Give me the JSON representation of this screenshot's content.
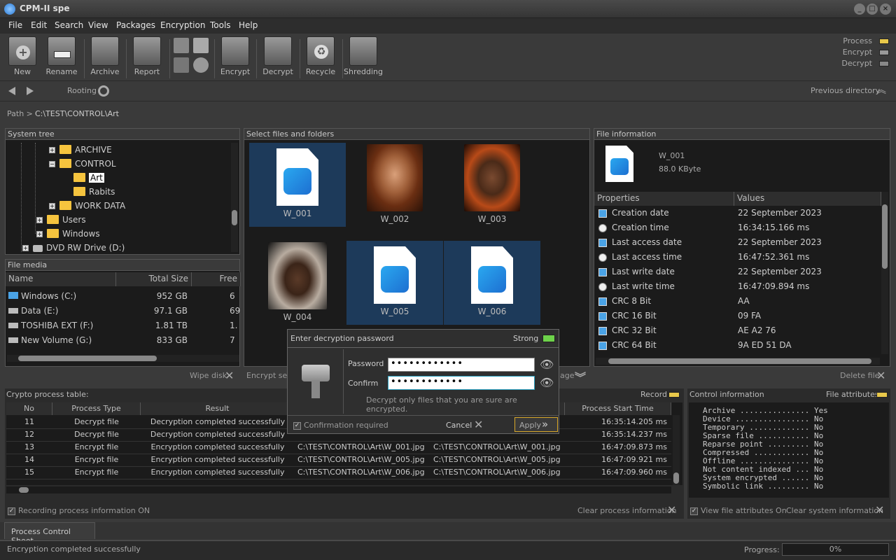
{
  "app": {
    "title": "CPM-II spe"
  },
  "menu": [
    "File",
    "Edit",
    "Search",
    "View",
    "Packages",
    "Encryption",
    "Tools",
    "Help"
  ],
  "toolbar": {
    "buttons": [
      "New",
      "Rename",
      "Archive",
      "Report",
      "Encrypt",
      "Decrypt",
      "Recycle",
      "Shredding"
    ]
  },
  "status_indicators": {
    "process": "Process",
    "encrypt": "Encrypt",
    "decrypt": "Decrypt",
    "colors": {
      "process": "#e8c84a",
      "encrypt": "#999999",
      "decrypt": "#888888"
    }
  },
  "nav": {
    "rooting": "Rooting",
    "previous_directory": "Previous directory"
  },
  "path": {
    "label": "Path >",
    "value": "C:\\TEST\\CONTROL\\Art"
  },
  "system_tree": {
    "title": "System tree",
    "items": [
      {
        "label": "ARCHIVE",
        "sign": "+"
      },
      {
        "label": "CONTROL",
        "sign": "−"
      },
      {
        "label": "Art",
        "sign": ""
      },
      {
        "label": "Rabits",
        "sign": ""
      },
      {
        "label": "WORK DATA",
        "sign": "+"
      },
      {
        "label": "Users",
        "sign": "+"
      },
      {
        "label": "Windows",
        "sign": "+"
      },
      {
        "label": "DVD RW Drive (D:)",
        "sign": "+"
      }
    ]
  },
  "file_media": {
    "title": "File media",
    "headers": [
      "Name",
      "Total Size",
      "Free"
    ],
    "rows": [
      {
        "name": "Windows  (C:)",
        "total": "952 GB",
        "free": "6"
      },
      {
        "name": "Data (E:)",
        "total": "97.1 GB",
        "free": "69"
      },
      {
        "name": "TOSHIBA EXT (F:)",
        "total": "1.81 TB",
        "free": "1."
      },
      {
        "name": "New Volume (G:)",
        "total": "833 GB",
        "free": "7"
      }
    ],
    "wipe": "Wipe disk"
  },
  "files": {
    "title": "Select files and folders",
    "items": [
      "W_001",
      "W_002",
      "W_003",
      "W_004",
      "W_005",
      "W_006"
    ],
    "encrypt_sel": "Encrypt sele",
    "page_frag": "age"
  },
  "file_info": {
    "title": "File information",
    "name": "W_001",
    "size": "88.0 KByte",
    "headers": [
      "Properties",
      "Values"
    ],
    "props": [
      {
        "k": "Creation date",
        "v": "22 September 2023",
        "ic": "cal"
      },
      {
        "k": "Creation time",
        "v": "16:34:15.166 ms",
        "ic": "clock"
      },
      {
        "k": "Last access date",
        "v": "22 September 2023",
        "ic": "cal"
      },
      {
        "k": "Last access time",
        "v": "16:47:52.361 ms",
        "ic": "clock"
      },
      {
        "k": "Last write date",
        "v": "22 September 2023",
        "ic": "cal"
      },
      {
        "k": "Last write time",
        "v": "16:47:09.894 ms",
        "ic": "clock"
      },
      {
        "k": "CRC 8 Bit",
        "v": "AA",
        "ic": "crc"
      },
      {
        "k": "CRC 16 Bit",
        "v": "09 FA",
        "ic": "crc"
      },
      {
        "k": "CRC 32 Bit",
        "v": "AE A2 76",
        "ic": "crc"
      },
      {
        "k": "CRC 64 Bit",
        "v": "9A ED 51 DA",
        "ic": "crc"
      }
    ],
    "delete": "Delete file"
  },
  "crypto": {
    "title": "Crypto process table:",
    "record": "Record",
    "headers": [
      "No",
      "Process Type",
      "Result",
      "",
      "",
      "Process Start Time"
    ],
    "rows": [
      {
        "no": "11",
        "type": "Decrypt file",
        "result": "Decryption completed successfully",
        "src": "",
        "dst": "",
        "time": "16:35:14.205 ms"
      },
      {
        "no": "12",
        "type": "Decrypt file",
        "result": "Decryption completed successfully",
        "src": "",
        "dst": "",
        "time": "16:35:14.237 ms"
      },
      {
        "no": "13",
        "type": "Encrypt file",
        "result": "Encryption completed successfully",
        "src": "C:\\TEST\\CONTROL\\Art\\W_001.jpg",
        "dst": "C:\\TEST\\CONTROL\\Art\\W_001.jpg",
        "time": "16:47:09.873 ms"
      },
      {
        "no": "14",
        "type": "Encrypt file",
        "result": "Encryption completed successfully",
        "src": "C:\\TEST\\CONTROL\\Art\\W_005.jpg",
        "dst": "C:\\TEST\\CONTROL\\Art\\W_005.jpg",
        "time": "16:47:09.921 ms"
      },
      {
        "no": "15",
        "type": "Encrypt file",
        "result": "Encryption completed successfully",
        "src": "C:\\TEST\\CONTROL\\Art\\W_006.jpg",
        "dst": "C:\\TEST\\CONTROL\\Art\\W_006.jpg",
        "time": "16:47:09.960 ms"
      }
    ],
    "recording": "Recording process information ON",
    "clear": "Clear process information"
  },
  "control": {
    "title": "Control information",
    "attrs_label": "File attributes",
    "lines": [
      "Archive ............... Yes",
      "Device ................ No",
      "Temporary ............. No",
      "Sparse file ........... No",
      "Reparse point ......... No",
      "Compressed ............ No",
      "Offline ............... No",
      "Not content indexed ... No",
      "System encrypted ...... No",
      "Symbolic link ......... No"
    ],
    "view": "View file attributes On",
    "clear": "Clear system information"
  },
  "dialog": {
    "title": "Enter decryption password",
    "strength": "Strong",
    "password_label": "Password",
    "confirm_label": "Confirm",
    "password_value": "••••••••••••",
    "confirm_value": "••••••••••••",
    "hint": "Decrypt only files that you are sure are encrypted.",
    "confirm_required": "Confirmation required",
    "cancel": "Cancel",
    "apply": "Apply"
  },
  "tabs": {
    "sheet": "Process Control Sheet"
  },
  "status": {
    "message": "Encryption completed successfully",
    "progress_label": "Progress:",
    "progress_value": "0%"
  }
}
